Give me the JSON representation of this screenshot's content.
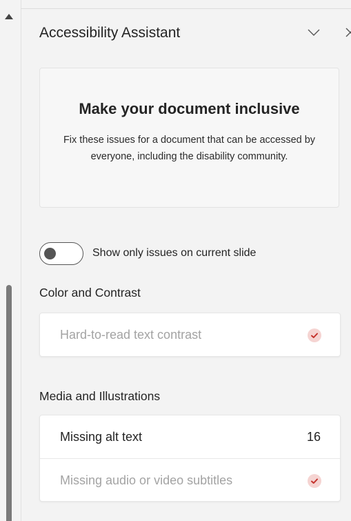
{
  "pane": {
    "title": "Accessibility Assistant"
  },
  "intro": {
    "heading": "Make your document inclusive",
    "body": "Fix these issues for a document that can be accessed by everyone, including the disability community."
  },
  "toggle": {
    "label": "Show only issues on current slide",
    "on": false
  },
  "sections": {
    "color_contrast": {
      "title": "Color and Contrast",
      "items": [
        {
          "label": "Hard-to-read text contrast",
          "status": "checked"
        }
      ]
    },
    "media": {
      "title": "Media and Illustrations",
      "items": [
        {
          "label": "Missing alt text",
          "count": "16"
        },
        {
          "label": "Missing audio or video subtitles",
          "status": "checked"
        }
      ]
    }
  },
  "colors": {
    "check_badge_bg": "#f5d4d2",
    "check_mark": "#c4312b",
    "scrollbar_thumb": "#7a7a7a"
  },
  "icons": {
    "collapse": "chevron-down-icon",
    "close": "close-icon",
    "scroll_up": "triangle-up-icon",
    "check": "check-icon"
  }
}
